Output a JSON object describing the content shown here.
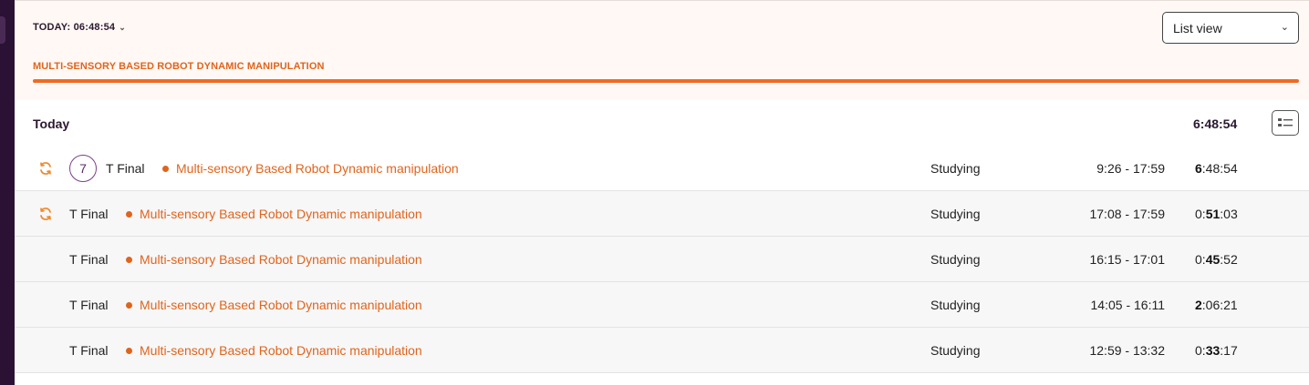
{
  "header": {
    "today_label": "TODAY: 06:48:54",
    "view_select": "List view",
    "project_name": "MULTI-SENSORY BASED ROBOT DYNAMIC MANIPULATION",
    "project_color": "#f06a22"
  },
  "group": {
    "title": "Today",
    "total": "6:48:54"
  },
  "entries": [
    {
      "has_sync": true,
      "count": "7",
      "task": "T Final",
      "project": "Multi-sensory Based Robot Dynamic manipulation",
      "tag": "Studying",
      "range": "9:26 - 17:59",
      "dur_prefix": "",
      "dur_bold": "6",
      "dur_rest": ":48:54"
    },
    {
      "has_sync": true,
      "task": "T Final",
      "project": "Multi-sensory Based Robot Dynamic manipulation",
      "tag": "Studying",
      "range": "17:08 - 17:59",
      "dur_prefix": "0:",
      "dur_bold": "51",
      "dur_rest": ":03"
    },
    {
      "has_sync": false,
      "task": "T Final",
      "project": "Multi-sensory Based Robot Dynamic manipulation",
      "tag": "Studying",
      "range": "16:15 - 17:01",
      "dur_prefix": "0:",
      "dur_bold": "45",
      "dur_rest": ":52"
    },
    {
      "has_sync": false,
      "task": "T Final",
      "project": "Multi-sensory Based Robot Dynamic manipulation",
      "tag": "Studying",
      "range": "14:05 - 16:11",
      "dur_prefix": "",
      "dur_bold": "2",
      "dur_rest": ":06:21"
    },
    {
      "has_sync": false,
      "task": "T Final",
      "project": "Multi-sensory Based Robot Dynamic manipulation",
      "tag": "Studying",
      "range": "12:59 - 13:32",
      "dur_prefix": "0:",
      "dur_bold": "33",
      "dur_rest": ":17"
    }
  ]
}
